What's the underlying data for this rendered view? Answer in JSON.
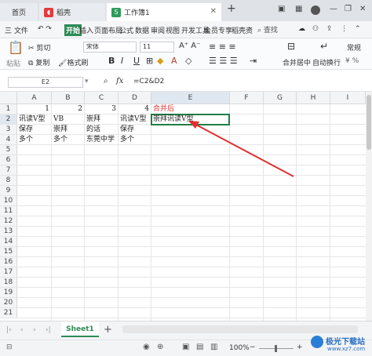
{
  "titlebar": {
    "home_tab": "首页",
    "doc_tab": "稻壳",
    "active_tab": "工作簿1",
    "active_badge": "S",
    "new_tab": "+",
    "close": "✕"
  },
  "menu": {
    "file": "三 文件",
    "items": [
      "开始",
      "插入",
      "页面布局",
      "公式",
      "数据",
      "审阅",
      "视图",
      "开发工具",
      "会员专享",
      "稻壳资"
    ],
    "search": "查找"
  },
  "ribbon": {
    "paste": "粘贴",
    "cut": "剪切",
    "copy": "复制",
    "format_painter": "格式刷",
    "font_name": "宋体",
    "font_size": "11",
    "bold": "B",
    "italic": "I",
    "underline": "U",
    "merge_center": "合并居中",
    "wrap_text": "自动换行",
    "number_format": "常规"
  },
  "formula_bar": {
    "name_box": "E2",
    "fx": "fx",
    "formula": "=C2&D2"
  },
  "grid": {
    "columns": [
      "A",
      "B",
      "C",
      "D",
      "E",
      "F",
      "G",
      "H",
      "I"
    ],
    "rows": [
      "1",
      "2",
      "3",
      "4",
      "5",
      "6",
      "7",
      "8",
      "9",
      "10",
      "11",
      "12",
      "13",
      "14",
      "15",
      "16",
      "17",
      "18",
      "19",
      "20",
      "21"
    ],
    "cells": {
      "A1": "1",
      "B1": "2",
      "C1": "3",
      "D1": "4",
      "E1": "合并后",
      "A2": "讯读V型",
      "B2": "VB",
      "C2": "崇拜",
      "D2": "讯读V型",
      "E2": "崇拜讯读V型",
      "A3": "保存",
      "B3": "崇拜",
      "C3": "的话",
      "D3": "保存",
      "A4": "多个",
      "B4": "多个",
      "C4": "东莞中学",
      "D4": "多个"
    },
    "highlight_color": "#e03030",
    "selection_color": "#1e7e45"
  },
  "sheetbar": {
    "sheet_tab": "Sheet1",
    "add": "+"
  },
  "statusbar": {
    "zoom": "100%",
    "zoom_minus": "−",
    "zoom_plus": "+"
  },
  "watermark": {
    "title": "极光下载站",
    "url": "www.xz7.com"
  }
}
